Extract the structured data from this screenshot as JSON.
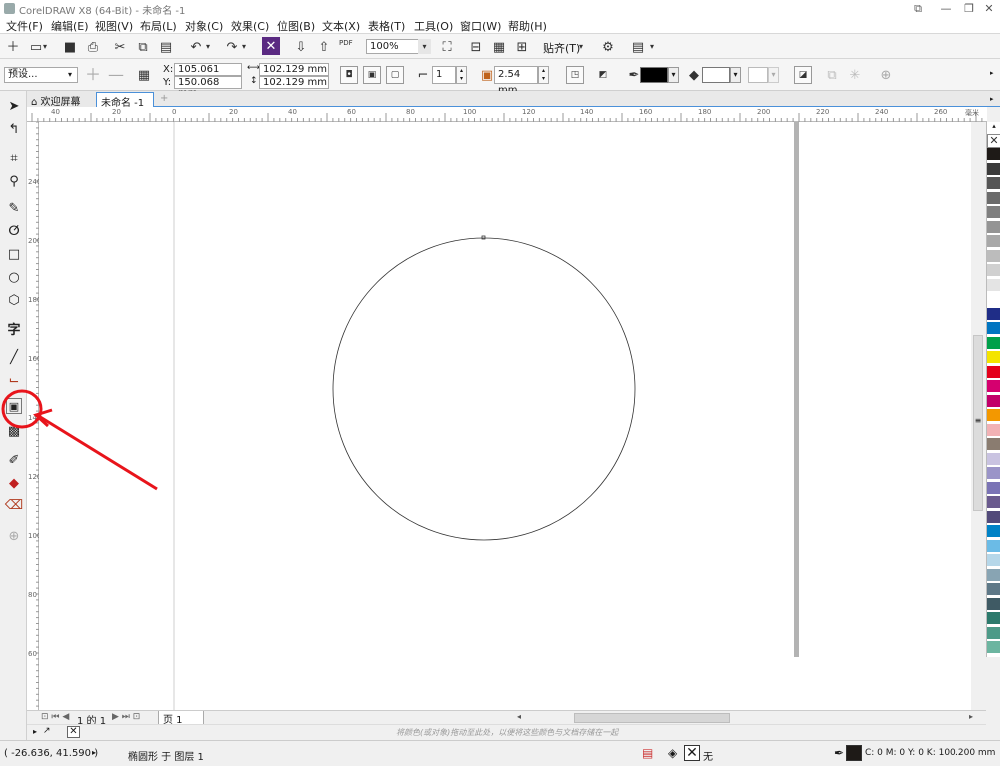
{
  "window": {
    "title": "CorelDRAW X8 (64-Bit) - 未命名 -1"
  },
  "menu": [
    "文件(F)",
    "编辑(E)",
    "视图(V)",
    "布局(L)",
    "对象(C)",
    "效果(C)",
    "位图(B)",
    "文本(X)",
    "表格(T)",
    "工具(O)",
    "窗口(W)",
    "帮助(H)"
  ],
  "standard_toolbar": {
    "pdf_label": "PDF",
    "zoom_value": "100%",
    "snap_label": "贴齐(T)"
  },
  "property_bar": {
    "preset": "预设...",
    "x_label": "X:",
    "x_value": "105.061 mm",
    "y_label": "Y:",
    "y_value": "150.068 mm",
    "width_value": "102.129 mm",
    "height_value": "102.129 mm",
    "steps_value": "1",
    "offset_value": "2.54 mm"
  },
  "tabs": {
    "welcome": "欢迎屏幕",
    "document": "未命名 -1",
    "add": "+"
  },
  "toolbox": {
    "text_tool_glyph": "字"
  },
  "rulers": {
    "h_ticks": [
      "40",
      "20",
      "0",
      "20",
      "40",
      "60",
      "80",
      "100",
      "120",
      "140",
      "160",
      "180",
      "200",
      "220",
      "240",
      "260"
    ],
    "h_unit": "毫米",
    "v_ticks": [
      "240",
      "220",
      "200",
      "180",
      "160",
      "140",
      "120",
      "100",
      "80",
      "60"
    ]
  },
  "page_nav": {
    "page_count": "1 的 1",
    "page_tab": "页 1"
  },
  "hint": "将颜色(或对象)拖动至此处，以便将这些颜色与文档存储在一起",
  "status": {
    "coords": "( -26.636, 41.590 )",
    "selection": "椭圆形 于 图层 1",
    "fill_none": "无",
    "outline_cmyk": "C: 0 M: 0 Y: 0 K: 100",
    "outline_width": ".200 mm"
  },
  "colors": {
    "accent": "#4a90d9",
    "annotation_red": "#e8141b"
  },
  "palette": [
    "#1e1a17",
    "#3b3b3b",
    "#555555",
    "#6b6b6b",
    "#7f7f7f",
    "#949494",
    "#a8a8a8",
    "#bcbcbc",
    "#d0d0d0",
    "#e4e4e4",
    "#ffffff",
    "#1f2d87",
    "#0075c1",
    "#00a04a",
    "#f4e400",
    "#e4001b",
    "#d5006f",
    "#c2006a",
    "#f39800",
    "#f2b2b5",
    "#8a7c70",
    "#c9c3e1",
    "#9a94c8",
    "#7a73b5",
    "#6a5a8e",
    "#524a7a",
    "#0082c6",
    "#6bbbe6",
    "#b6d7e9",
    "#88a4b3",
    "#5e7887",
    "#3f5a64",
    "#2c7a6c",
    "#4d9a88",
    "#6cb5a0"
  ]
}
